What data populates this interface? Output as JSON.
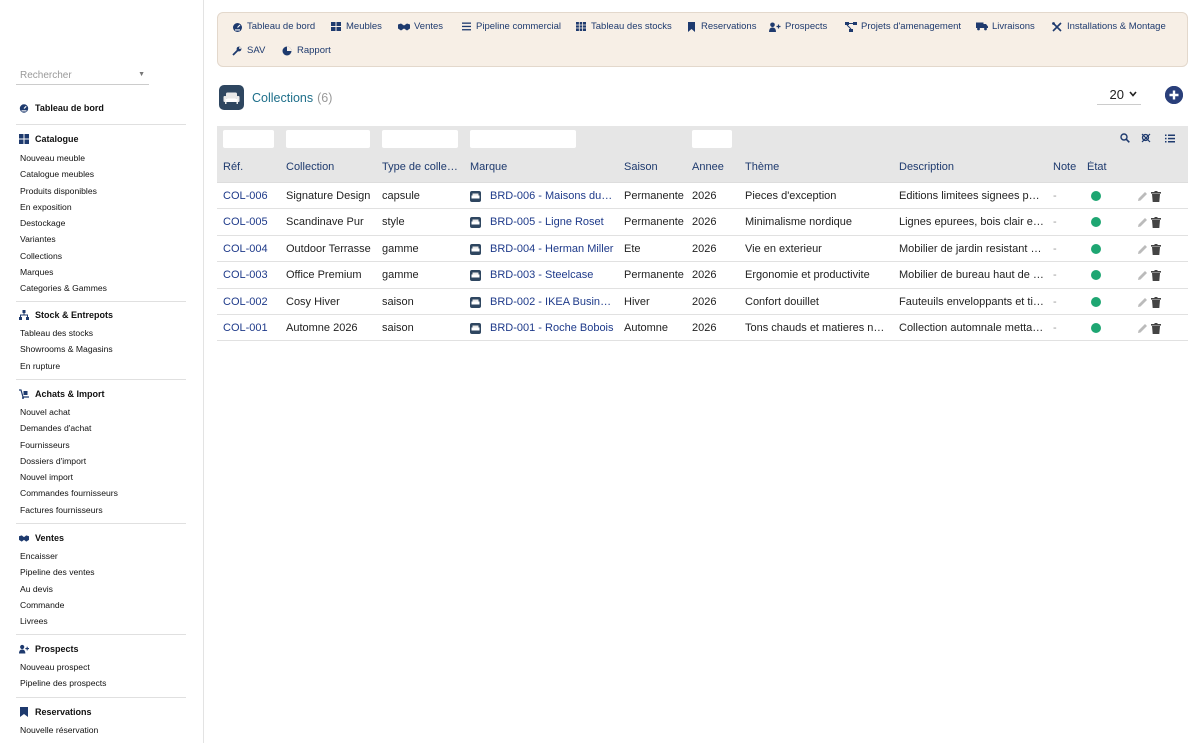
{
  "sidebar": {
    "search_placeholder": "Rechercher",
    "dashboard_label": "Tableau de bord",
    "sections": [
      {
        "title": "Catalogue",
        "icon": "grid-icon",
        "items": [
          "Nouveau meuble",
          "Catalogue meubles",
          "Produits disponibles",
          "En exposition",
          "Destockage",
          "Variantes",
          "Collections",
          "Marques",
          "Categories & Gammes"
        ]
      },
      {
        "title": "Stock & Entrepots",
        "icon": "sitemap-icon",
        "items": [
          "Tableau des stocks",
          "Showrooms & Magasins",
          "En rupture"
        ]
      },
      {
        "title": "Achats & Import",
        "icon": "dolly-icon",
        "items": [
          "Nouvel achat",
          "Demandes d'achat",
          "Fournisseurs",
          "Dossiers d'import",
          "Nouvel import",
          "Commandes fournisseurs",
          "Factures fournisseurs"
        ]
      },
      {
        "title": "Ventes",
        "icon": "handshake-icon",
        "items": [
          "Encaisser",
          "Pipeline des ventes",
          "Au devis",
          "Commande",
          "Livrees"
        ]
      },
      {
        "title": "Prospects",
        "icon": "user-plus-icon",
        "items": [
          "Nouveau prospect",
          "Pipeline des prospects"
        ]
      },
      {
        "title": "Reservations",
        "icon": "bookmark-icon",
        "items": [
          "Nouvelle réservation"
        ]
      }
    ]
  },
  "topnav": {
    "items": [
      {
        "label": "Tableau de bord",
        "icon": "gauge-icon"
      },
      {
        "label": "Meubles",
        "icon": "grid-icon"
      },
      {
        "label": "Ventes",
        "icon": "handshake-icon"
      },
      {
        "label": "Pipeline commercial",
        "icon": "bars-icon"
      },
      {
        "label": "Tableau des stocks",
        "icon": "table-icon"
      },
      {
        "label": "Reservations",
        "icon": "bookmark-icon"
      },
      {
        "label": "Prospects",
        "icon": "user-plus-icon"
      },
      {
        "label": "Projets d'amenagement",
        "icon": "project-diagram-icon"
      },
      {
        "label": "Livraisons",
        "icon": "truck-icon"
      },
      {
        "label": "Installations & Montage",
        "icon": "tools-icon"
      },
      {
        "label": "SAV",
        "icon": "wrench-icon"
      },
      {
        "label": "Rapport",
        "icon": "chart-pie-icon"
      }
    ]
  },
  "page": {
    "title": "Collections",
    "count": "(6)",
    "per_page": "20"
  },
  "table": {
    "columns": [
      "Réf.",
      "Collection",
      "Type de colle…",
      "Marque",
      "Saison",
      "Annee",
      "Thème",
      "Description",
      "Note",
      "État"
    ],
    "rows": [
      {
        "ref": "COL-006",
        "collection": "Signature Design",
        "type": "capsule",
        "brand": "BRD-006 - Maisons du …",
        "season": "Permanente",
        "year": "2026",
        "theme": "Pieces d'exception",
        "description": "Editions limitees signees pa…",
        "note": "-"
      },
      {
        "ref": "COL-005",
        "collection": "Scandinave Pur",
        "type": "style",
        "brand": "BRD-005 - Ligne Roset",
        "season": "Permanente",
        "year": "2026",
        "theme": "Minimalisme nordique",
        "description": "Lignes epurees, bois clair et…",
        "note": "-"
      },
      {
        "ref": "COL-004",
        "collection": "Outdoor Terrasse",
        "type": "gamme",
        "brand": "BRD-004 - Herman Miller",
        "season": "Ete",
        "year": "2026",
        "theme": "Vie en exterieur",
        "description": "Mobilier de jardin resistant e…",
        "note": "-"
      },
      {
        "ref": "COL-003",
        "collection": "Office Premium",
        "type": "gamme",
        "brand": "BRD-003 - Steelcase",
        "season": "Permanente",
        "year": "2026",
        "theme": "Ergonomie et productivite",
        "description": "Mobilier de bureau haut de …",
        "note": "-"
      },
      {
        "ref": "COL-002",
        "collection": "Cosy Hiver",
        "type": "saison",
        "brand": "BRD-002 - IKEA Business",
        "season": "Hiver",
        "year": "2026",
        "theme": "Confort douillet",
        "description": "Fauteuils enveloppants et ti…",
        "note": "-"
      },
      {
        "ref": "COL-001",
        "collection": "Automne 2026",
        "type": "saison",
        "brand": "BRD-001 - Roche Bobois",
        "season": "Automne",
        "year": "2026",
        "theme": "Tons chauds et matieres nat…",
        "description": "Collection automnale metta…",
        "note": "-"
      }
    ]
  },
  "colors": {
    "accent": "#1e3a6e",
    "status_ok": "#1ea672",
    "nav_bg": "#f7efe6"
  }
}
